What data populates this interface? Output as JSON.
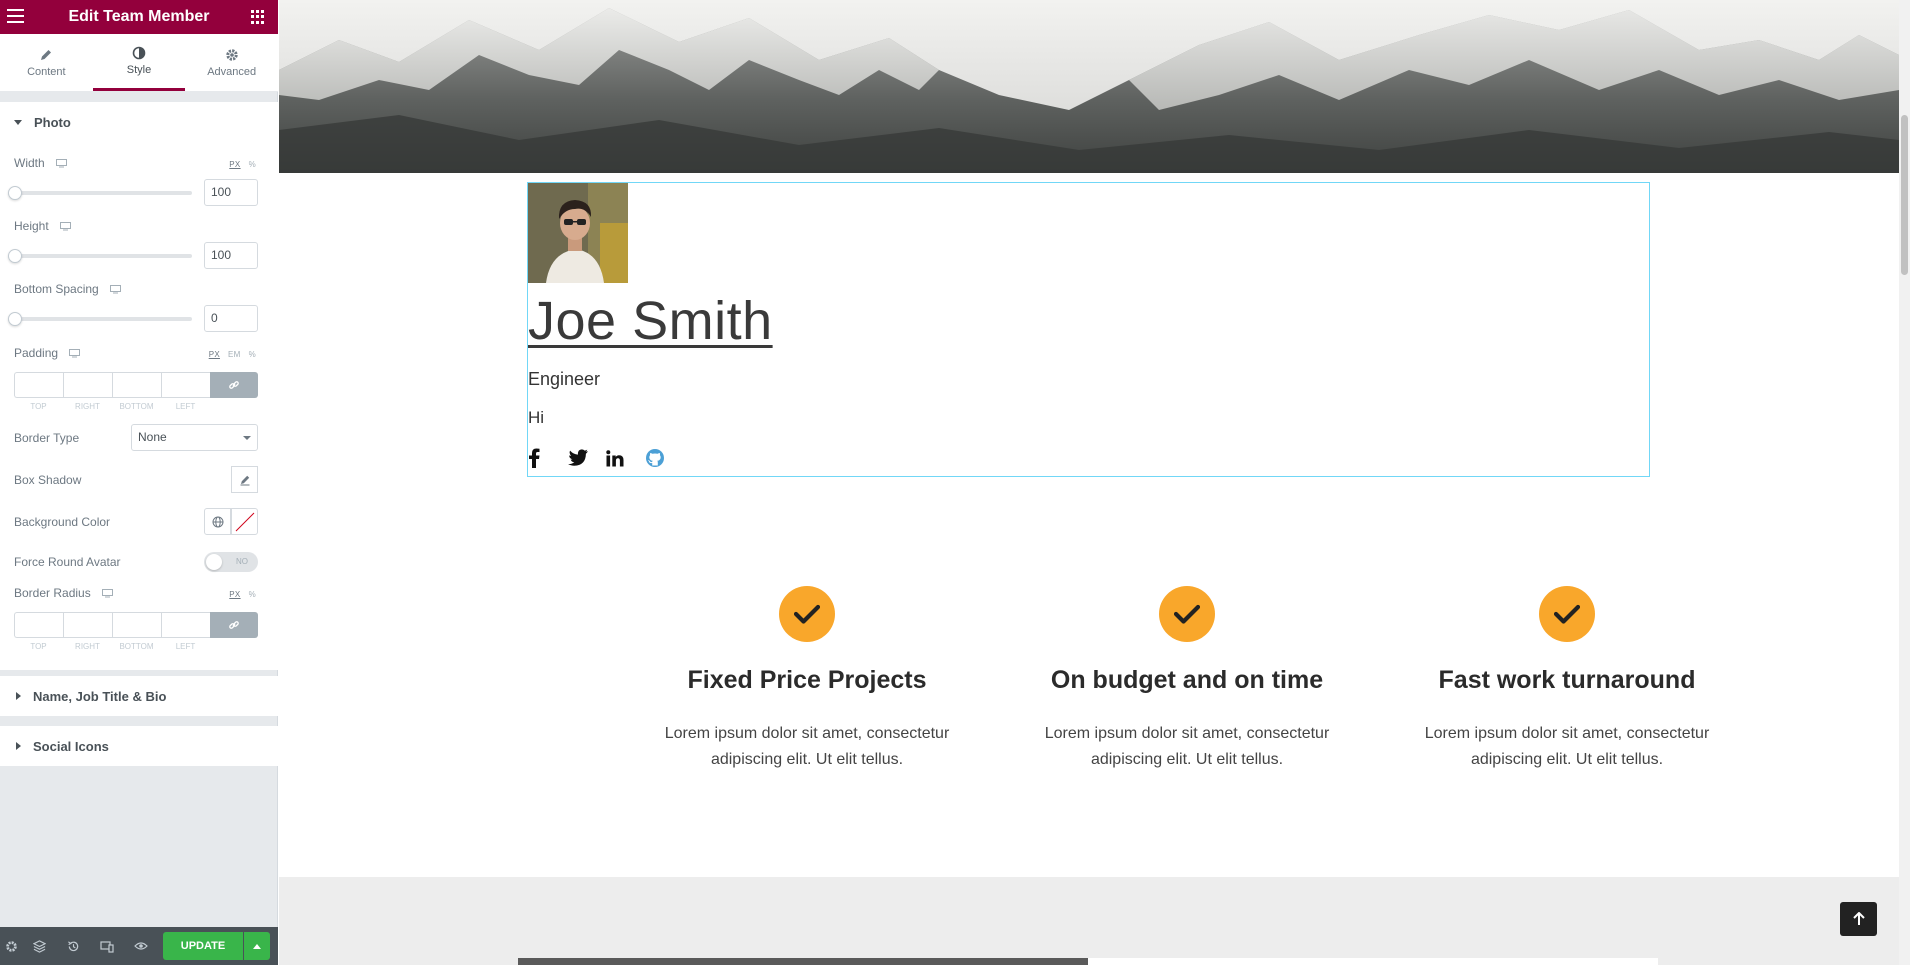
{
  "panel": {
    "title": "Edit Team Member",
    "tabs": [
      {
        "label": "Content",
        "icon": "pencil-icon"
      },
      {
        "label": "Style",
        "icon": "contrast-icon",
        "active": true
      },
      {
        "label": "Advanced",
        "icon": "gear-icon"
      }
    ],
    "photo_section": {
      "title": "Photo",
      "width": {
        "label": "Width",
        "units": [
          "PX",
          "%"
        ],
        "value": "100",
        "slider_fraction": 0
      },
      "height": {
        "label": "Height",
        "value": "100",
        "slider_fraction": 0
      },
      "bottom_spacing": {
        "label": "Bottom Spacing",
        "value": "0",
        "slider_fraction": 0
      },
      "padding": {
        "label": "Padding",
        "units": [
          "PX",
          "EM",
          "%"
        ],
        "sides": [
          "TOP",
          "RIGHT",
          "BOTTOM",
          "LEFT"
        ]
      },
      "border_type": {
        "label": "Border Type",
        "value": "None"
      },
      "box_shadow": {
        "label": "Box Shadow"
      },
      "background_color": {
        "label": "Background Color"
      },
      "force_round_avatar": {
        "label": "Force Round Avatar",
        "state": "NO"
      },
      "border_radius": {
        "label": "Border Radius",
        "units": [
          "PX",
          "%"
        ],
        "sides": [
          "TOP",
          "RIGHT",
          "BOTTOM",
          "LEFT"
        ]
      }
    },
    "collapsed_sections": [
      "Name, Job Title & Bio",
      "Social Icons"
    ],
    "footer": {
      "update_label": "UPDATE"
    }
  },
  "preview": {
    "member": {
      "name": "Joe Smith",
      "job": "Engineer",
      "bio": "Hi",
      "social_icons": [
        "facebook-icon",
        "twitter-icon",
        "linkedin-icon",
        "github-icon"
      ]
    },
    "features": [
      {
        "title": "Fixed Price Projects",
        "text": "Lorem ipsum dolor sit amet, consectetur adipiscing elit. Ut elit tellus."
      },
      {
        "title": "On budget and on time",
        "text": "Lorem ipsum dolor sit amet, consectetur adipiscing elit. Ut elit tellus."
      },
      {
        "title": "Fast work turnaround",
        "text": "Lorem ipsum dolor sit amet, consectetur adipiscing elit. Ut elit tellus."
      }
    ]
  },
  "colors": {
    "panel_header": "#93003c",
    "update_button": "#39b54a",
    "feature_accent": "#f9a72b",
    "selection_outline": "#71d7f7"
  }
}
